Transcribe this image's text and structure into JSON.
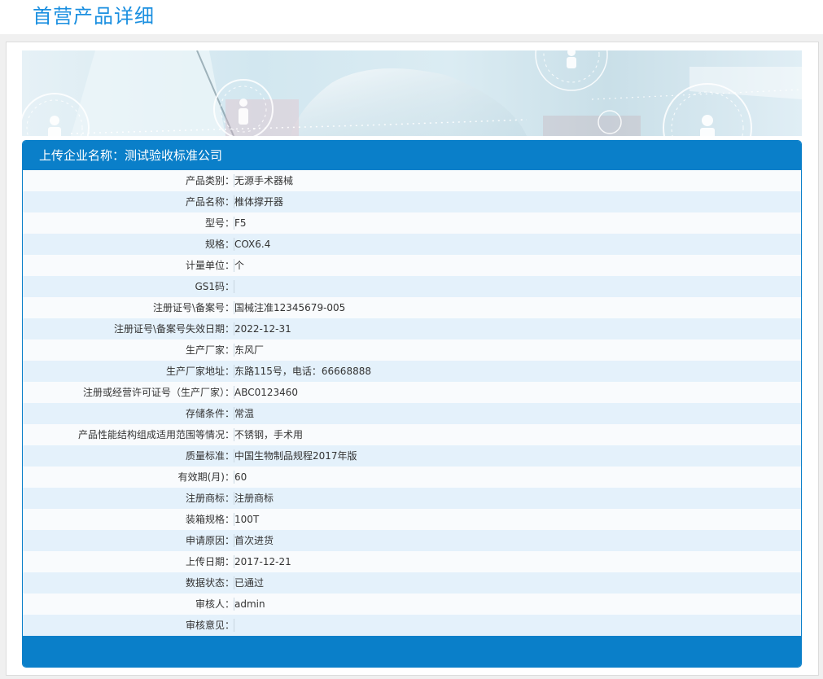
{
  "page": {
    "title": "首营产品详细"
  },
  "card": {
    "company_label": "上传企业名称：",
    "company_name": "测试验收标准公司"
  },
  "rows": [
    {
      "label": "产品类别：",
      "value": "无源手术器械"
    },
    {
      "label": "产品名称：",
      "value": "椎体撑开器"
    },
    {
      "label": "型号：",
      "value": "F5"
    },
    {
      "label": "规格：",
      "value": "COX6.4"
    },
    {
      "label": "计量单位：",
      "value": "个"
    },
    {
      "label": "GS1码：",
      "value": ""
    },
    {
      "label": "注册证号\\备案号：",
      "value": "国械注准12345679-005"
    },
    {
      "label": "注册证号\\备案号失效日期：",
      "value": "2022-12-31"
    },
    {
      "label": "生产厂家：",
      "value": "东风厂"
    },
    {
      "label": "生产厂家地址：",
      "value": "东路115号，电话：66668888"
    },
    {
      "label": "注册或经营许可证号（生产厂家）：",
      "value": "ABC0123460"
    },
    {
      "label": "存储条件：",
      "value": "常温"
    },
    {
      "label": "产品性能结构组成适用范围等情况：",
      "value": "不锈钢，手术用"
    },
    {
      "label": "质量标准：",
      "value": "中国生物制品规程2017年版"
    },
    {
      "label": "有效期(月)：",
      "value": "60"
    },
    {
      "label": "注册商标：",
      "value": "注册商标"
    },
    {
      "label": "装箱规格：",
      "value": "100T"
    },
    {
      "label": "申请原因：",
      "value": "首次进货"
    },
    {
      "label": "上传日期：",
      "value": "2017-12-21"
    },
    {
      "label": "数据状态：",
      "value": "已通过"
    },
    {
      "label": "审核人：",
      "value": "admin"
    },
    {
      "label": "审核意见：",
      "value": ""
    }
  ],
  "colors": {
    "accent": "#0a7fc9",
    "title": "#1a8fe0",
    "row_alt": "#e4f1fb"
  },
  "icons": {
    "banner": "user-circle-icon"
  }
}
